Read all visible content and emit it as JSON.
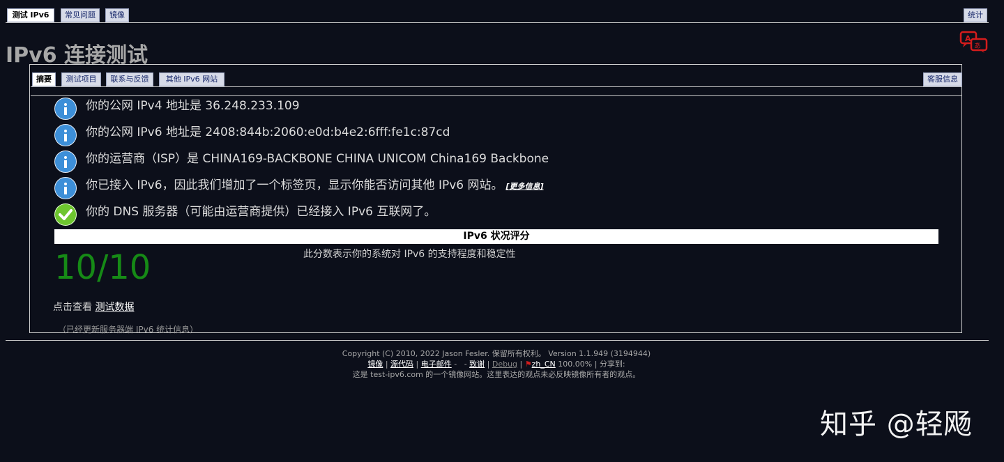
{
  "top_tabs": {
    "test": "测试 IPv6",
    "faq": "常见问题",
    "mirror": "镜像",
    "stats": "统计"
  },
  "title": "IPv6 连接测试",
  "sub_tabs": {
    "summary": "摘要",
    "tests": "测试项目",
    "contact": "联系与反馈",
    "other_sites": "其他 IPv6 网站",
    "support": "客服信息"
  },
  "info_rows": [
    {
      "text": "你的公网 IPv4 地址是 36.248.233.109",
      "icon": "info-icon"
    },
    {
      "text": "你的公网 IPv6 地址是 2408:844b:2060:e0d:b4e2:6fff:fe1c:87cd",
      "icon": "info-icon"
    },
    {
      "text": "你的运营商（ISP）是 CHINA169-BACKBONE CHINA UNICOM China169 Backbone",
      "icon": "info-icon"
    },
    {
      "text": "你已接入 IPv6，因此我们增加了一个标签页，显示你能否访问其他 IPv6 网站。",
      "icon": "info-icon",
      "link": "[更多信息]"
    },
    {
      "text": "你的 DNS 服务器（可能由运营商提供）已经接入 IPv6 互联网了。",
      "icon": "check-icon"
    }
  ],
  "score": {
    "header": "IPv6 状况评分",
    "value": "10/10",
    "description": "此分数表示你的系统对 IPv6 的支持程度和稳定性"
  },
  "view_data": {
    "prefix": "点击查看 ",
    "link": "测试数据"
  },
  "stats_note": "（已经更新服务器端 IPv6 统计信息）",
  "footer": {
    "copyright": "Copyright (C) 2010, 2022 Jason Fesler. 保留所有权利。 Version 1.1.949 (3194944)",
    "links": {
      "mirror": "镜像",
      "source": "源代码",
      "email": "电子邮件",
      "thanks": "致谢",
      "debug": "Debug",
      "locale": "zh_CN",
      "locale_pct": "100.00%",
      "share": "分享到:"
    },
    "note": "这是 test-ipv6.com 的一个镜像网站。这里表达的观点未必反映镜像所有者的观点。"
  },
  "watermark": "知乎 @轻飏",
  "colors": {
    "background": "#0c0f1a",
    "tab_bg": "#d7dbe8",
    "info_blue": "#3d8fd8",
    "check_green": "#6ec62f",
    "score_green": "#168a16",
    "lang_icon_red": "#d41c1c"
  }
}
